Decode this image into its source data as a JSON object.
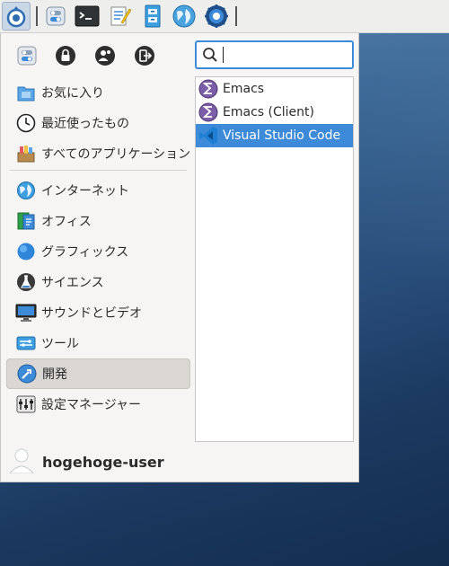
{
  "panel": {
    "launchers": [
      {
        "name": "whisker-menu-icon"
      },
      {
        "name": "settings-toggle-icon"
      },
      {
        "name": "terminal-icon"
      },
      {
        "name": "text-editor-icon"
      },
      {
        "name": "file-manager-icon"
      },
      {
        "name": "web-browser-icon"
      },
      {
        "name": "gear-app-icon"
      }
    ]
  },
  "quick_actions": [
    {
      "name": "settings-icon"
    },
    {
      "name": "lock-screen-icon"
    },
    {
      "name": "switch-user-icon"
    },
    {
      "name": "logout-icon"
    }
  ],
  "search": {
    "value": "",
    "placeholder": ""
  },
  "categories_top": [
    {
      "label": "お気に入り",
      "icon": "favorites-icon"
    },
    {
      "label": "最近使ったもの",
      "icon": "clock-icon"
    },
    {
      "label": "すべてのアプリケーション",
      "icon": "all-apps-icon"
    }
  ],
  "categories": [
    {
      "label": "インターネット",
      "icon": "internet-icon"
    },
    {
      "label": "オフィス",
      "icon": "office-icon"
    },
    {
      "label": "グラフィックス",
      "icon": "graphics-icon"
    },
    {
      "label": "サイエンス",
      "icon": "science-icon"
    },
    {
      "label": "サウンドとビデオ",
      "icon": "multimedia-icon"
    },
    {
      "label": "ツール",
      "icon": "tools-icon"
    },
    {
      "label": "開発",
      "icon": "development-icon",
      "active": true
    },
    {
      "label": "設定マネージャー",
      "icon": "settings-manager-icon"
    }
  ],
  "apps": [
    {
      "label": "Emacs",
      "icon": "emacs-icon"
    },
    {
      "label": "Emacs (Client)",
      "icon": "emacs-icon"
    },
    {
      "label": "Visual Studio Code",
      "icon": "vscode-icon",
      "selected": true
    }
  ],
  "user": {
    "name": "hogehoge-user"
  },
  "colors": {
    "accent": "#3d8ad8",
    "menu_bg": "#f6f5f4",
    "active_category": "#d9d6d3"
  }
}
